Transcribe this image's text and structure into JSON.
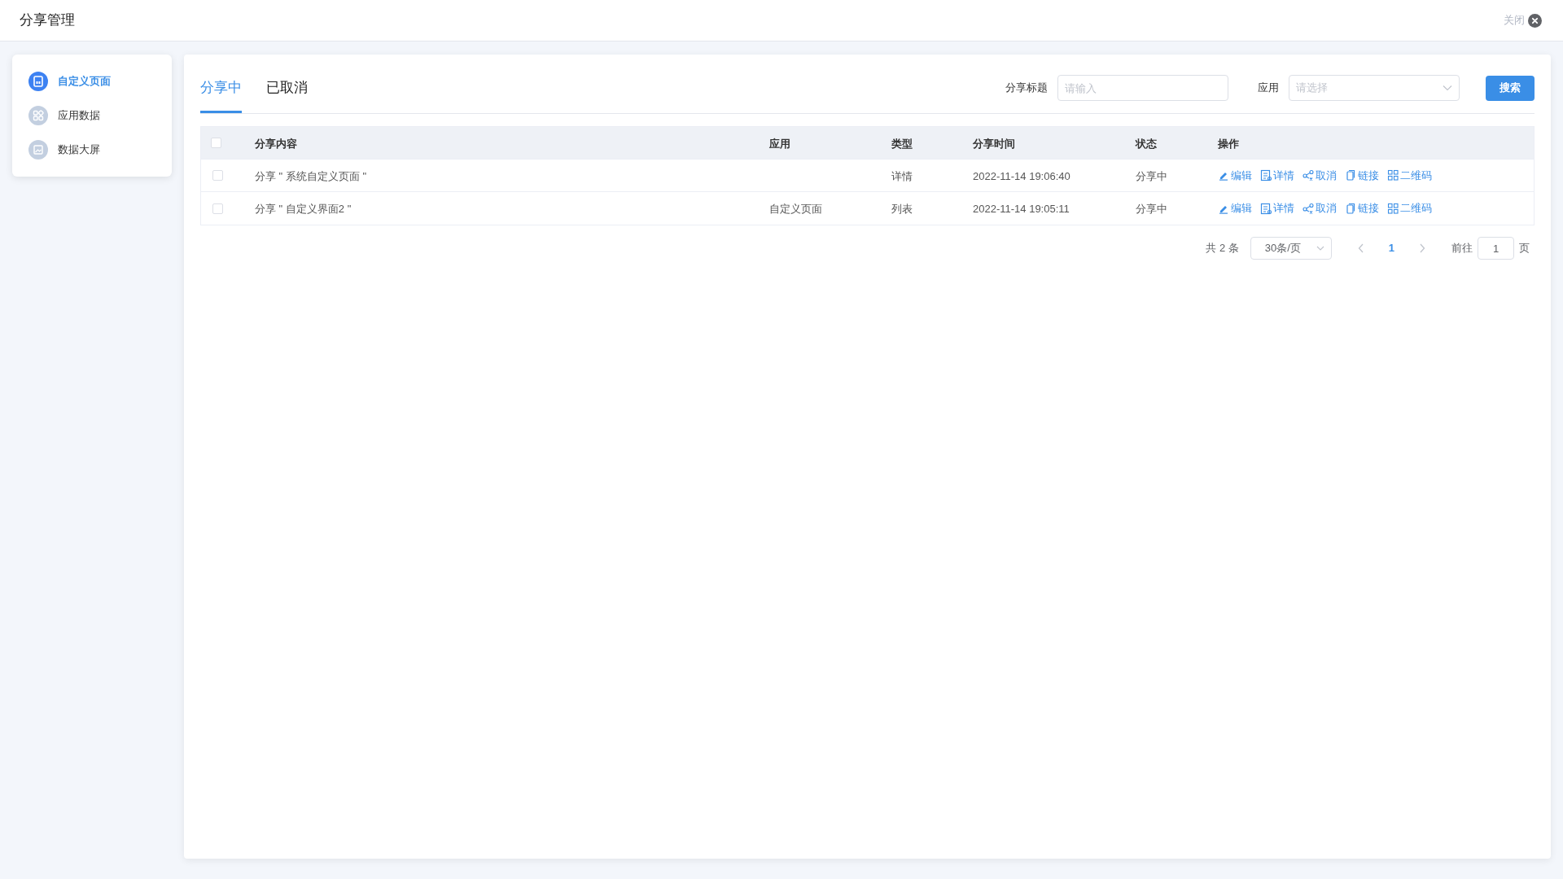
{
  "header": {
    "title": "分享管理",
    "close_label": "关闭"
  },
  "sidebar": {
    "items": [
      {
        "label": "自定义页面",
        "kind": "page",
        "selected": true
      },
      {
        "label": "应用数据",
        "kind": "apps",
        "selected": false
      },
      {
        "label": "数据大屏",
        "kind": "screen",
        "selected": false
      }
    ]
  },
  "tabs": [
    {
      "label": "分享中",
      "selected": true
    },
    {
      "label": "已取消",
      "selected": false
    }
  ],
  "filters": {
    "title_label": "分享标题",
    "title_placeholder": "请输入",
    "app_label": "应用",
    "app_placeholder": "请选择",
    "search_button": "搜索"
  },
  "table": {
    "select_all_checked": false,
    "columns": [
      "分享内容",
      "应用",
      "类型",
      "分享时间",
      "状态",
      "操作"
    ],
    "rows": [
      {
        "checked": false,
        "content": "分享 \" 系统自定义页面 \"",
        "app": "",
        "type": "详情",
        "time": "2022-11-14 19:06:40",
        "status": "分享中",
        "actions": [
          {
            "kind": "edit",
            "label": "编辑"
          },
          {
            "kind": "detail",
            "label": "详情"
          },
          {
            "kind": "share",
            "label": "取消"
          },
          {
            "kind": "link",
            "label": "链接"
          },
          {
            "kind": "qr",
            "label": "二维码"
          }
        ]
      },
      {
        "checked": false,
        "content": "分享 \" 自定义界面2 \"",
        "app": "自定义页面",
        "type": "列表",
        "time": "2022-11-14 19:05:11",
        "status": "分享中",
        "actions": [
          {
            "kind": "edit",
            "label": "编辑"
          },
          {
            "kind": "detail",
            "label": "详情"
          },
          {
            "kind": "share",
            "label": "取消"
          },
          {
            "kind": "link",
            "label": "链接"
          },
          {
            "kind": "qr",
            "label": "二维码"
          }
        ]
      }
    ]
  },
  "pagination": {
    "total": "共 2 条",
    "page_size": "30条/页",
    "pages": [
      {
        "label": "1",
        "selected": true
      }
    ],
    "goto_label": "前往",
    "goto_value": "1",
    "page_suffix": "页"
  }
}
